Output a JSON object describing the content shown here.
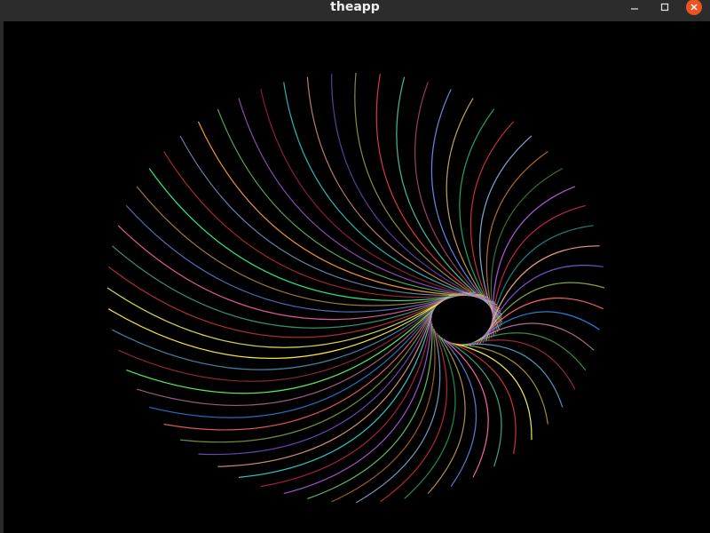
{
  "window": {
    "title": "theapp",
    "controls": {
      "minimize_icon": "minimize-icon",
      "maximize_icon": "maximize-icon",
      "close_icon": "close-icon",
      "close_color": "#e95420"
    }
  },
  "canvas": {
    "background": "#000000",
    "line_count": 64,
    "palette": [
      "#ffff66",
      "#ff4444",
      "#66ffcc",
      "#ff66aa",
      "#6699ff",
      "#ffcc66",
      "#33ff99",
      "#cc3333",
      "#99ccff",
      "#ff9933",
      "#66cc66",
      "#cc66ff",
      "#ff3366",
      "#33cccc",
      "#ffaa88",
      "#9966ff",
      "#ccff66",
      "#ff6666",
      "#3399ff",
      "#ff99cc",
      "#66ff66",
      "#aa3344",
      "#66ccff",
      "#ffee44"
    ]
  }
}
